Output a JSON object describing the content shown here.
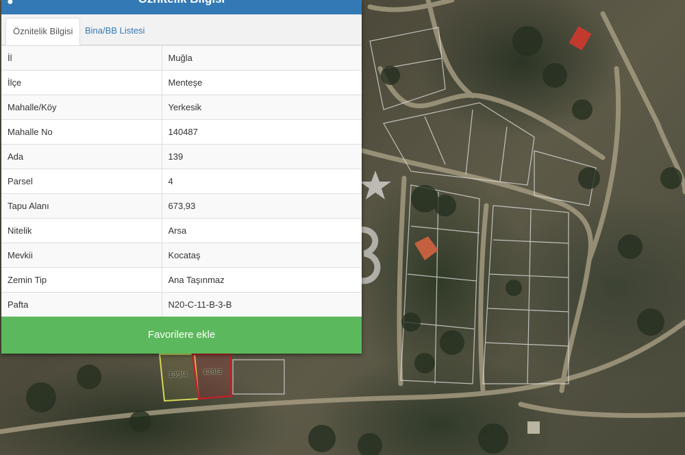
{
  "panel": {
    "title": "Öznitelik Bilgisi",
    "tabs": [
      {
        "label": "Öznitelik Bilgisi",
        "active": true
      },
      {
        "label": "Bina/BB Listesi",
        "active": false
      }
    ],
    "rows": [
      {
        "key": "İl",
        "value": "Muğla"
      },
      {
        "key": "İlçe",
        "value": "Menteşe"
      },
      {
        "key": "Mahalle/Köy",
        "value": "Yerkesik"
      },
      {
        "key": "Mahalle No",
        "value": "140487"
      },
      {
        "key": "Ada",
        "value": "139"
      },
      {
        "key": "Parsel",
        "value": "4"
      },
      {
        "key": "Tapu Alanı",
        "value": "673,93"
      },
      {
        "key": "Nitelik",
        "value": "Arsa"
      },
      {
        "key": "Mevkii",
        "value": "Kocataş"
      },
      {
        "key": "Zemin Tip",
        "value": "Ana Taşınmaz"
      },
      {
        "key": "Pafta",
        "value": "N20-C-11-B-3-B"
      }
    ],
    "favorite_button": "Favorilere ekle",
    "header_icon": "map-marker-icon",
    "collapse_icon": "chevron-up-icon"
  },
  "map": {
    "parcel_labels": [
      "139/4",
      "139/3"
    ],
    "parcel_colors": {
      "selected": "#c0202a",
      "neighbor": "#d8d85a"
    }
  },
  "watermark": {
    "text": "CB",
    "icon": "star-logo-watermark"
  },
  "colors": {
    "header": "#3379b5",
    "button": "#5cb85c",
    "tab_link": "#3379b5"
  }
}
